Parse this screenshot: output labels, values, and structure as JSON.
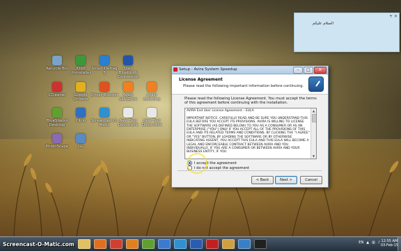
{
  "desktop_icons": [
    {
      "label": "Recycle Bin",
      "color": "#7aa3c8"
    },
    {
      "label": "IObit Uninstaller",
      "color": "#3a9a3a"
    },
    {
      "label": "Smart Defrag 3",
      "color": "#2a7fd0"
    },
    {
      "label": "Start Bluetooth Connection",
      "color": "#2255aa"
    },
    {
      "label": "CCleaner",
      "color": "#d03030"
    },
    {
      "label": "Google Chrome",
      "color": "#e0b020"
    },
    {
      "label": "Driver Booster",
      "color": "#e05020"
    },
    {
      "label": "Avast SafeZone",
      "color": "#f08020"
    },
    {
      "label": "Avast Antivirus",
      "color": "#f08020"
    },
    {
      "label": "BlueStacks Desktop",
      "color": "#60a030"
    },
    {
      "label": "Citrio",
      "color": "#3070c0"
    },
    {
      "label": "Screencast-O-Matic",
      "color": "#3090d0"
    },
    {
      "label": "New Text Document",
      "color": "#e8e8e8"
    },
    {
      "label": "New Text Document",
      "color": "#e8e8e8"
    },
    {
      "label": "PhotoScape",
      "color": "#8a6ab0"
    },
    {
      "label": "GG",
      "color": "#5a8ac0"
    }
  ],
  "sticky_note": {
    "text": "السلام عليكم"
  },
  "dialog": {
    "title": "Setup - Avira System Speedup",
    "header_title": "License Agreement",
    "header_subtitle": "Please read the following important information before continuing.",
    "intro": "Please read the following License Agreement. You must accept the terms of this agreement before continuing with the installation.",
    "license_text": "AVIRA End User License Agreement – EULA\n\nIMPORTANT NOTICE: CAREFULLY READ AND BE SURE YOU UNDERSTAND THIS EULA BEFORE YOU ACCEPT ITS PROVISIONS. AVIRA IS WILLING TO LICENSE THE SOFTWARE (AS DEFINED BELOW) TO YOU AS A CONSUMER OR AS AN ENTERPRISE (\"YOU\") ONLY IF YOU ACCEPT ALL OF THE PROVISIONS OF THIS EULA AND ITS RELATED TERMS AND CONDITIONS. BY CLICKING THE \"I AGREE\" OR \"YES\" BUTTON, BY LOADING THE SOFTWARE OR BY OTHERWISE INDICATING ASSENT, YOU ACCEPT THIS EULA AND THIS EULA WILL BECOME A LEGAL AND ENFORCEABLE CONTRACT BETWEEN AVIRA AND YOU INDIVIDUALLY, IF YOU ARE A CONSUMER OR BETWEEN AVIRA AND YOUR BUSINESS ENTITY, IF YOU",
    "radio_accept": "I accept the agreement",
    "radio_decline": "I do not accept the agreement",
    "back_label": "< Back",
    "next_label": "Next >",
    "cancel_label": "Cancel"
  },
  "taskbar": {
    "watermark": "Screencast-O-Matic.com",
    "language": "EN",
    "time": "12:55 AM",
    "date": "03-Feb-15",
    "apps": [
      {
        "name": "explorer-icon",
        "color": "#e0c060"
      },
      {
        "name": "media-player-icon",
        "color": "#e07020"
      },
      {
        "name": "chrome-icon",
        "color": "#d04030"
      },
      {
        "name": "firefox-icon",
        "color": "#e08020"
      },
      {
        "name": "bluestacks-icon",
        "color": "#60a030"
      },
      {
        "name": "app-icon",
        "color": "#3a7ad0"
      },
      {
        "name": "screencast-icon",
        "color": "#3090d0"
      },
      {
        "name": "word-icon",
        "color": "#2b5cb0"
      },
      {
        "name": "avira-icon",
        "color": "#c02020"
      },
      {
        "name": "folder-icon",
        "color": "#d0a040"
      },
      {
        "name": "avira-setup-icon",
        "color": "#3a7fc4"
      },
      {
        "name": "video-icon",
        "color": "#202020"
      }
    ]
  }
}
